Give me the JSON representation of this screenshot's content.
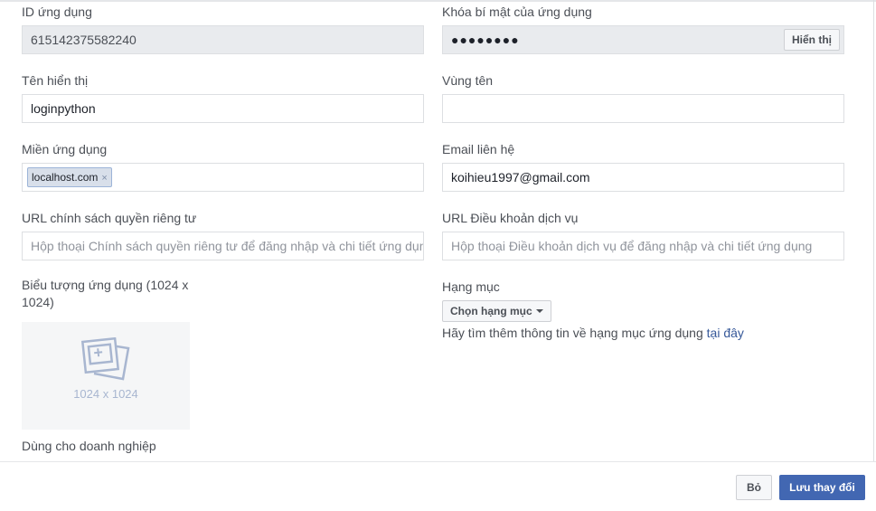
{
  "app_id": {
    "label": "ID ứng dụng",
    "value": "615142375582240"
  },
  "app_secret": {
    "label": "Khóa bí mật của ứng dụng",
    "masked_value": "●●●●●●●●",
    "show_label": "Hiển thị"
  },
  "display_name": {
    "label": "Tên hiển thị",
    "value": "loginpython"
  },
  "namespace": {
    "label": "Vùng tên",
    "value": ""
  },
  "app_domains": {
    "label": "Miền ứng dụng",
    "tokens": [
      "localhost.com"
    ],
    "remove_glyph": "×"
  },
  "contact_email": {
    "label": "Email liên hệ",
    "value": "koihieu1997@gmail.com"
  },
  "privacy_url": {
    "label": "URL chính sách quyền riêng tư",
    "placeholder": "Hộp thoại Chính sách quyền riêng tư để đăng nhập và chi tiết ứng dụng"
  },
  "tos_url": {
    "label": "URL Điều khoản dịch vụ",
    "placeholder": "Hộp thoại Điều khoản dịch vụ để đăng nhập và chi tiết ứng dụng"
  },
  "app_icon": {
    "label": "Biểu tượng ứng dụng (1024 x 1024)",
    "size_text": "1024 x 1024"
  },
  "category": {
    "label": "Hạng mục",
    "button_label": "Chọn hạng mục",
    "hint_text": "Hãy tìm thêm thông tin về hạng mục ứng dụng ",
    "hint_link": "tại đây"
  },
  "business": {
    "label": "Dùng cho doanh nghiệp"
  },
  "footer": {
    "cancel_label": "Bỏ",
    "save_label": "Lưu thay đổi"
  },
  "colors": {
    "primary": "#4267b2",
    "link": "#365899",
    "readonly_bg": "#e9ebee"
  }
}
